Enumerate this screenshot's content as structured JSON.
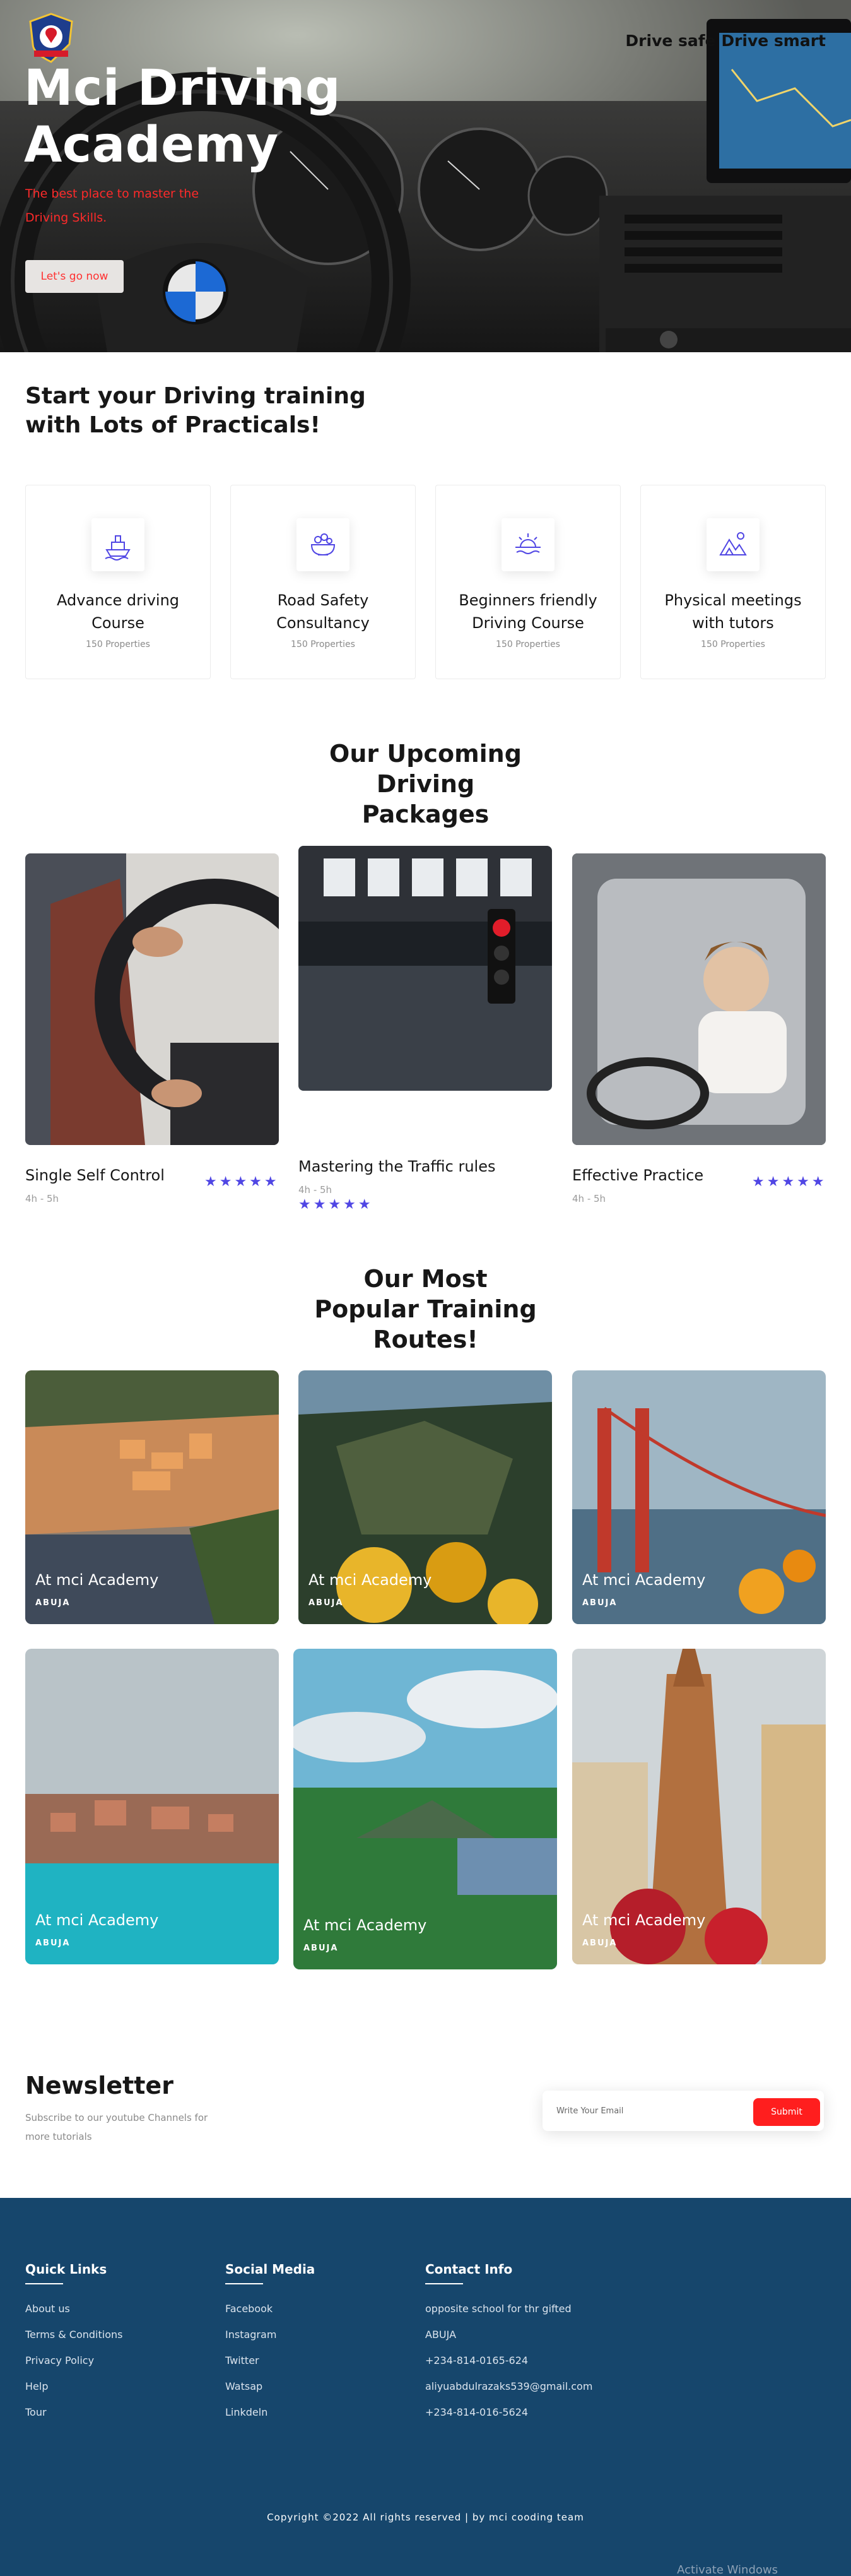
{
  "hero": {
    "tagline": "Drive safe Drive smart",
    "title": "Mci Driving Academy",
    "subtitle": "The best place to master the Driving Skills.",
    "cta_label": "Let's go now",
    "logo_icon": "academy-crest-logo"
  },
  "services": {
    "title": "Start your Driving training with Lots of Practicals!",
    "items": [
      {
        "icon": "ship-icon",
        "title": "Advance driving Course",
        "sub": "150 Properties"
      },
      {
        "icon": "food-bowl-icon",
        "title": "Road Safety Consultancy",
        "sub": "150 Properties"
      },
      {
        "icon": "sunrise-icon",
        "title": "Beginners friendly Driving Course",
        "sub": "150 Properties"
      },
      {
        "icon": "mountain-icon",
        "title": "Physical meetings with tutors",
        "sub": "150 Properties"
      }
    ]
  },
  "packages": {
    "title": "Our Upcoming Driving Packages",
    "items": [
      {
        "name": "Single Self Control",
        "duration": "4h - 5h",
        "stars": "★★★★★"
      },
      {
        "name": "Mastering the Traffic rules",
        "duration": "4h - 5h",
        "stars": "★★★★★"
      },
      {
        "name": "Effective Practice",
        "duration": "4h - 5h",
        "stars": "★★★★★"
      }
    ],
    "star_color": "#5046e4"
  },
  "routes": {
    "title": "Our Most Popular Training Routes!",
    "items": [
      {
        "title": "At mci Academy",
        "sub": "ABUJA"
      },
      {
        "title": "At mci Academy",
        "sub": "ABUJA"
      },
      {
        "title": "At mci Academy",
        "sub": "ABUJA"
      },
      {
        "title": "At mci Academy",
        "sub": "ABUJA"
      },
      {
        "title": "At mci Academy",
        "sub": "ABUJA"
      },
      {
        "title": "At mci Academy",
        "sub": "ABUJA"
      }
    ]
  },
  "newsletter": {
    "title": "Newsletter",
    "subtitle": "Subscribe to our youtube Channels for more tutorials",
    "placeholder": "Write Your Email",
    "button": "Submit",
    "accent": "#ff1e1e"
  },
  "footer": {
    "background": "#16466c",
    "quick_links": {
      "title": "Quick Links",
      "items": [
        "About us",
        "Terms & Conditions",
        "Privacy Policy",
        "Help",
        "Tour"
      ]
    },
    "social": {
      "title": "Social Media",
      "items": [
        "Facebook",
        "Instagram",
        "Twitter",
        "Watsap",
        "Linkdeln"
      ]
    },
    "contact": {
      "title": "Contact Info",
      "items": [
        "opposite school for thr gifted",
        "ABUJA",
        "+234-814-0165-624",
        "aliyuabdulrazaks539@gmail.com",
        "+234-814-016-5624"
      ]
    },
    "copyright": "Copyright ©2022 All rights reserved | by mci cooding team"
  },
  "os_watermark": "Activate Windows"
}
